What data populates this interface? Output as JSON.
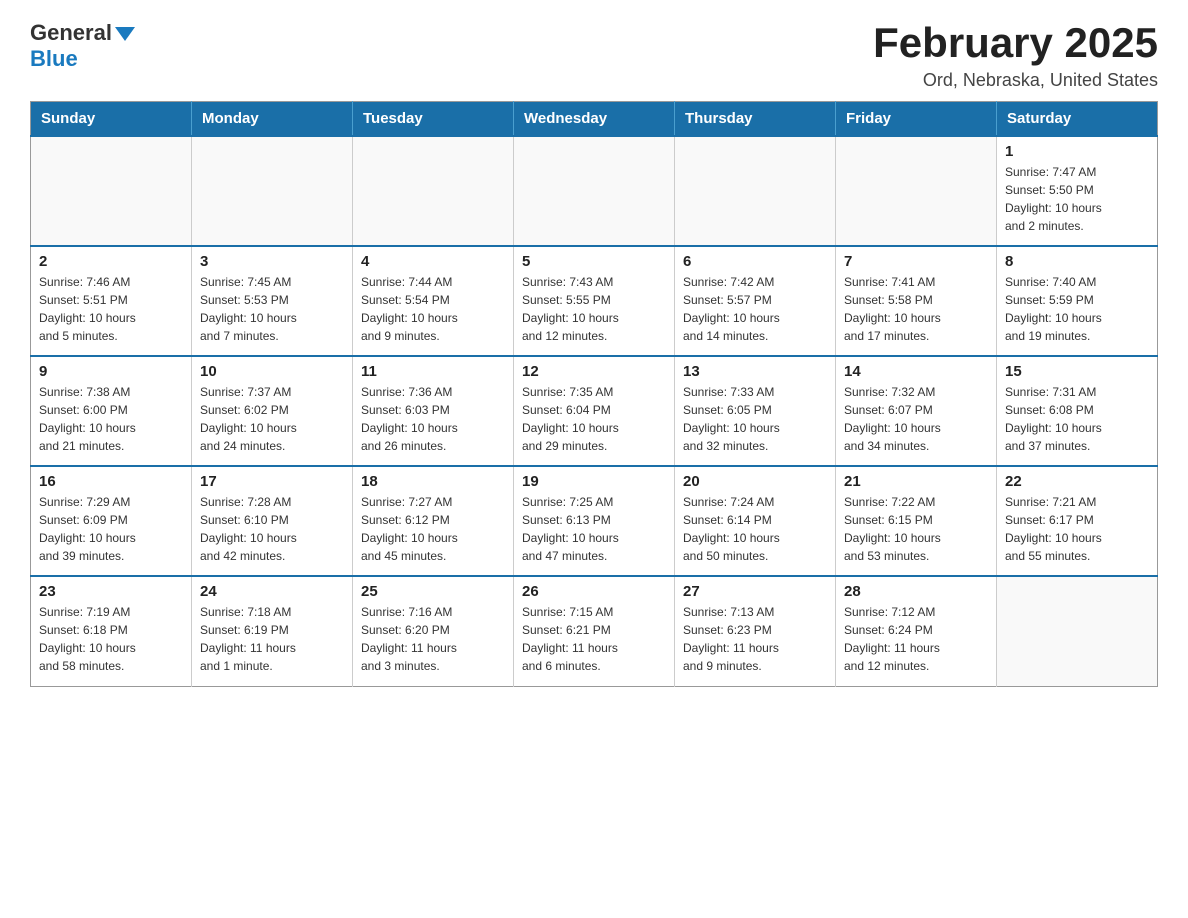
{
  "header": {
    "logo_general": "General",
    "logo_blue": "Blue",
    "title": "February 2025",
    "location": "Ord, Nebraska, United States"
  },
  "days_of_week": [
    "Sunday",
    "Monday",
    "Tuesday",
    "Wednesday",
    "Thursday",
    "Friday",
    "Saturday"
  ],
  "weeks": [
    [
      {
        "day": "",
        "info": ""
      },
      {
        "day": "",
        "info": ""
      },
      {
        "day": "",
        "info": ""
      },
      {
        "day": "",
        "info": ""
      },
      {
        "day": "",
        "info": ""
      },
      {
        "day": "",
        "info": ""
      },
      {
        "day": "1",
        "info": "Sunrise: 7:47 AM\nSunset: 5:50 PM\nDaylight: 10 hours\nand 2 minutes."
      }
    ],
    [
      {
        "day": "2",
        "info": "Sunrise: 7:46 AM\nSunset: 5:51 PM\nDaylight: 10 hours\nand 5 minutes."
      },
      {
        "day": "3",
        "info": "Sunrise: 7:45 AM\nSunset: 5:53 PM\nDaylight: 10 hours\nand 7 minutes."
      },
      {
        "day": "4",
        "info": "Sunrise: 7:44 AM\nSunset: 5:54 PM\nDaylight: 10 hours\nand 9 minutes."
      },
      {
        "day": "5",
        "info": "Sunrise: 7:43 AM\nSunset: 5:55 PM\nDaylight: 10 hours\nand 12 minutes."
      },
      {
        "day": "6",
        "info": "Sunrise: 7:42 AM\nSunset: 5:57 PM\nDaylight: 10 hours\nand 14 minutes."
      },
      {
        "day": "7",
        "info": "Sunrise: 7:41 AM\nSunset: 5:58 PM\nDaylight: 10 hours\nand 17 minutes."
      },
      {
        "day": "8",
        "info": "Sunrise: 7:40 AM\nSunset: 5:59 PM\nDaylight: 10 hours\nand 19 minutes."
      }
    ],
    [
      {
        "day": "9",
        "info": "Sunrise: 7:38 AM\nSunset: 6:00 PM\nDaylight: 10 hours\nand 21 minutes."
      },
      {
        "day": "10",
        "info": "Sunrise: 7:37 AM\nSunset: 6:02 PM\nDaylight: 10 hours\nand 24 minutes."
      },
      {
        "day": "11",
        "info": "Sunrise: 7:36 AM\nSunset: 6:03 PM\nDaylight: 10 hours\nand 26 minutes."
      },
      {
        "day": "12",
        "info": "Sunrise: 7:35 AM\nSunset: 6:04 PM\nDaylight: 10 hours\nand 29 minutes."
      },
      {
        "day": "13",
        "info": "Sunrise: 7:33 AM\nSunset: 6:05 PM\nDaylight: 10 hours\nand 32 minutes."
      },
      {
        "day": "14",
        "info": "Sunrise: 7:32 AM\nSunset: 6:07 PM\nDaylight: 10 hours\nand 34 minutes."
      },
      {
        "day": "15",
        "info": "Sunrise: 7:31 AM\nSunset: 6:08 PM\nDaylight: 10 hours\nand 37 minutes."
      }
    ],
    [
      {
        "day": "16",
        "info": "Sunrise: 7:29 AM\nSunset: 6:09 PM\nDaylight: 10 hours\nand 39 minutes."
      },
      {
        "day": "17",
        "info": "Sunrise: 7:28 AM\nSunset: 6:10 PM\nDaylight: 10 hours\nand 42 minutes."
      },
      {
        "day": "18",
        "info": "Sunrise: 7:27 AM\nSunset: 6:12 PM\nDaylight: 10 hours\nand 45 minutes."
      },
      {
        "day": "19",
        "info": "Sunrise: 7:25 AM\nSunset: 6:13 PM\nDaylight: 10 hours\nand 47 minutes."
      },
      {
        "day": "20",
        "info": "Sunrise: 7:24 AM\nSunset: 6:14 PM\nDaylight: 10 hours\nand 50 minutes."
      },
      {
        "day": "21",
        "info": "Sunrise: 7:22 AM\nSunset: 6:15 PM\nDaylight: 10 hours\nand 53 minutes."
      },
      {
        "day": "22",
        "info": "Sunrise: 7:21 AM\nSunset: 6:17 PM\nDaylight: 10 hours\nand 55 minutes."
      }
    ],
    [
      {
        "day": "23",
        "info": "Sunrise: 7:19 AM\nSunset: 6:18 PM\nDaylight: 10 hours\nand 58 minutes."
      },
      {
        "day": "24",
        "info": "Sunrise: 7:18 AM\nSunset: 6:19 PM\nDaylight: 11 hours\nand 1 minute."
      },
      {
        "day": "25",
        "info": "Sunrise: 7:16 AM\nSunset: 6:20 PM\nDaylight: 11 hours\nand 3 minutes."
      },
      {
        "day": "26",
        "info": "Sunrise: 7:15 AM\nSunset: 6:21 PM\nDaylight: 11 hours\nand 6 minutes."
      },
      {
        "day": "27",
        "info": "Sunrise: 7:13 AM\nSunset: 6:23 PM\nDaylight: 11 hours\nand 9 minutes."
      },
      {
        "day": "28",
        "info": "Sunrise: 7:12 AM\nSunset: 6:24 PM\nDaylight: 11 hours\nand 12 minutes."
      },
      {
        "day": "",
        "info": ""
      }
    ]
  ]
}
